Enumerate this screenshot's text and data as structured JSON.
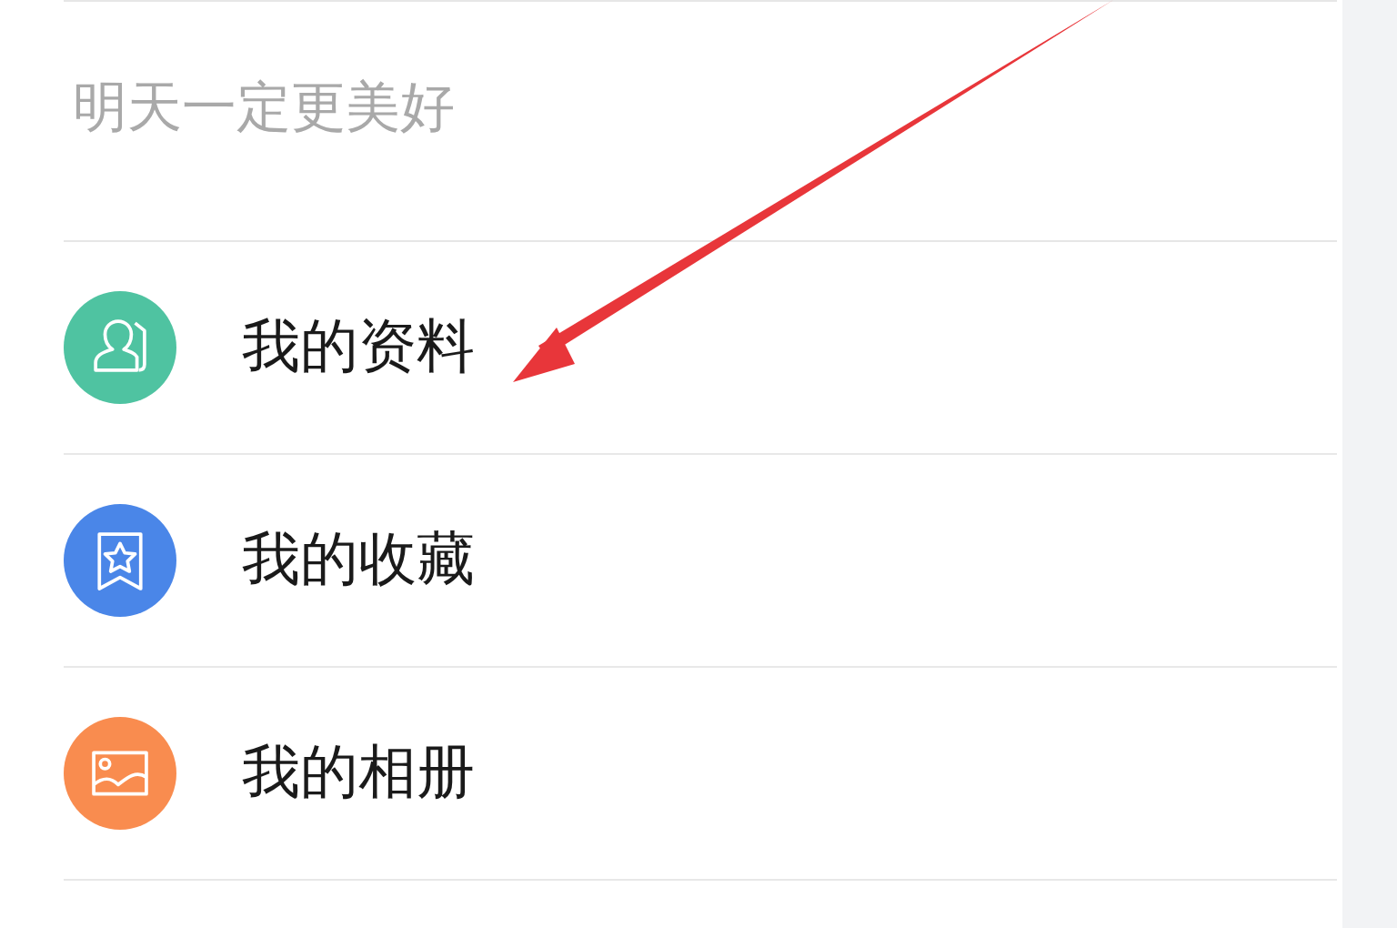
{
  "signature": "明天一定更美好",
  "menu": [
    {
      "label": "我的资料",
      "kind": "profile",
      "color": "#4fc3a1"
    },
    {
      "label": "我的收藏",
      "kind": "bookmark",
      "color": "#4a86e8"
    },
    {
      "label": "我的相册",
      "kind": "photo",
      "color": "#f98c4f"
    }
  ]
}
